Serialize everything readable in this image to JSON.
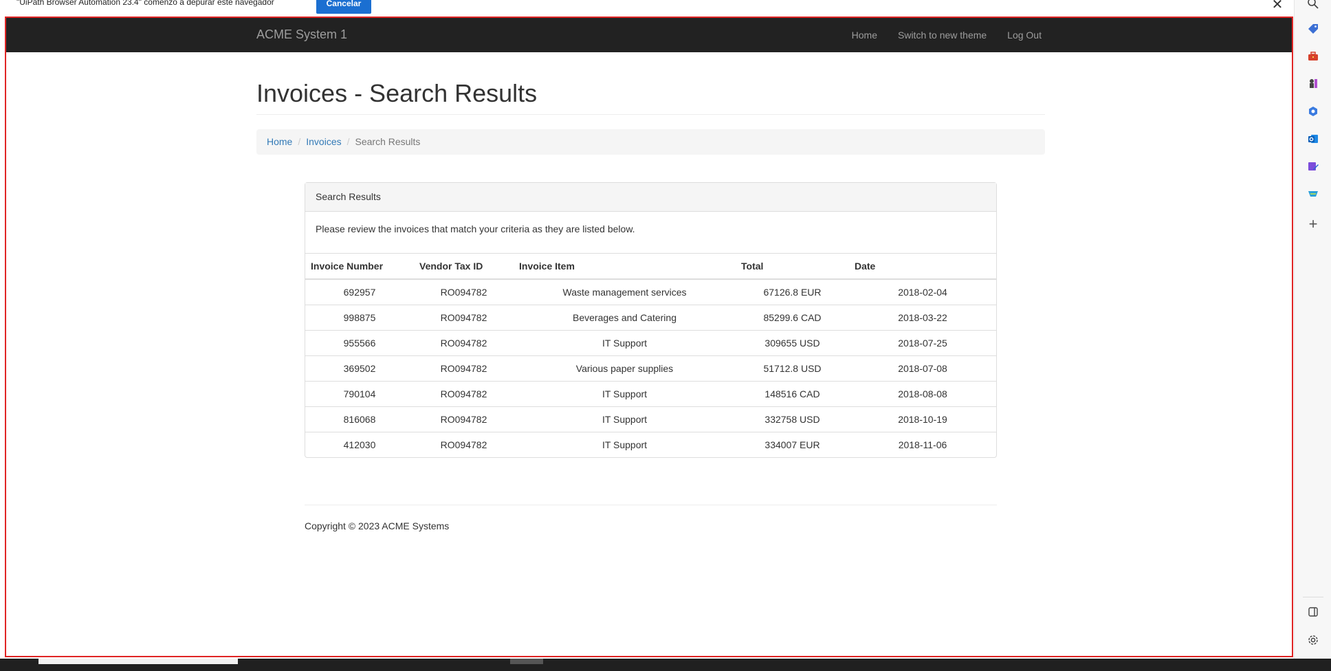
{
  "debug_bar": {
    "message": "\"UiPath Browser Automation 23.4\" comenzó a depurar este navegador",
    "cancel_label": "Cancelar",
    "close_symbol": "✕"
  },
  "navbar": {
    "brand": "ACME System 1",
    "links": [
      "Home",
      "Switch to new theme",
      "Log Out"
    ]
  },
  "page_title": "Invoices - Search Results",
  "breadcrumb": {
    "items": [
      "Home",
      "Invoices"
    ],
    "active": "Search Results",
    "separator": "/"
  },
  "panel": {
    "heading": "Search Results",
    "description": "Please review the invoices that match your criteria as they are listed below."
  },
  "table": {
    "headers": [
      "Invoice Number",
      "Vendor Tax ID",
      "Invoice Item",
      "Total",
      "Date"
    ],
    "rows": [
      [
        "692957",
        "RO094782",
        "Waste management services",
        "67126.8 EUR",
        "2018-02-04"
      ],
      [
        "998875",
        "RO094782",
        "Beverages and Catering",
        "85299.6 CAD",
        "2018-03-22"
      ],
      [
        "955566",
        "RO094782",
        "IT Support",
        "309655 USD",
        "2018-07-25"
      ],
      [
        "369502",
        "RO094782",
        "Various paper supplies",
        "51712.8 USD",
        "2018-07-08"
      ],
      [
        "790104",
        "RO094782",
        "IT Support",
        "148516 CAD",
        "2018-08-08"
      ],
      [
        "816068",
        "RO094782",
        "IT Support",
        "332758 USD",
        "2018-10-19"
      ],
      [
        "412030",
        "RO094782",
        "IT Support",
        "334007 EUR",
        "2018-11-06"
      ]
    ]
  },
  "footer": "Copyright © 2023 ACME Systems",
  "sidebar_icons": [
    "search-icon",
    "tag-icon",
    "toolbox-icon",
    "chess-icon",
    "copilot-icon",
    "outlook-icon",
    "editor-icon",
    "shopping-icon",
    "plus-icon",
    "split-view-icon",
    "settings-icon"
  ],
  "colors": {
    "navbar_bg": "#222222",
    "link": "#337ab7",
    "cancel_button": "#1b6fd1",
    "frame_border": "#e02424"
  }
}
